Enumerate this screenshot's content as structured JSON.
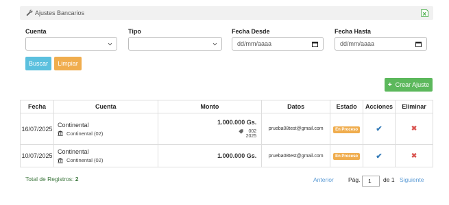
{
  "header": {
    "title": "Ajustes Bancarios",
    "icon": "wrench-icon",
    "export_icon": "excel-export-icon"
  },
  "filters": {
    "cuenta": {
      "label": "Cuenta",
      "value": ""
    },
    "tipo": {
      "label": "Tipo",
      "value": ""
    },
    "fecha_desde": {
      "label": "Fecha Desde",
      "placeholder": "dd/mm/aaaa"
    },
    "fecha_hasta": {
      "label": "Fecha Hasta",
      "placeholder": "dd/mm/aaaa"
    }
  },
  "buttons": {
    "buscar": "Buscar",
    "limpiar": "Limpiar",
    "crear": "Crear Ajuste",
    "crear_icon": "+"
  },
  "table": {
    "headers": [
      "Fecha",
      "Cuenta",
      "Monto",
      "Datos",
      "Estado",
      "Acciones",
      "Eliminar"
    ],
    "rows": [
      {
        "fecha": "16/07/2025",
        "cuenta": "Continental",
        "cuenta_sub": "Continental (02)",
        "monto": "1.000.000 Gs.",
        "tag": "002",
        "year": "2025",
        "datos": "prueba08test@gmail.com",
        "estado": "En Proceso",
        "accion": "✔",
        "eliminar": "✖"
      },
      {
        "fecha": "10/07/2025",
        "cuenta": "Continental",
        "cuenta_sub": "Continental (02)",
        "monto": "1.000.000 Gs.",
        "datos": "prueba08test@gmail.com",
        "estado": "En Proceso",
        "accion": "✔",
        "eliminar": "✖"
      }
    ]
  },
  "footer": {
    "total_label": "Total de Registros:",
    "total_value": "2"
  },
  "pagination": {
    "prev": "Anterior",
    "page_label": "Pág.",
    "page": "1",
    "of": "de 1",
    "next": "Siguiente"
  },
  "colors": {
    "info": "#5bc0de",
    "warning": "#f0ad4e",
    "success": "#5cb85c",
    "danger": "#d9534f",
    "link": "#5b9bd5"
  }
}
